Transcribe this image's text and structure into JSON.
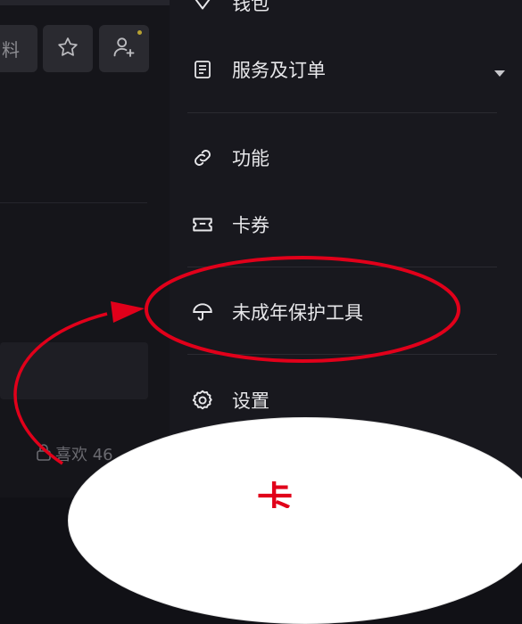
{
  "left_panel": {
    "profile_tab_label": "料",
    "likes_text": "喜欢 46"
  },
  "drawer": {
    "items": [
      {
        "label": "钱包",
        "icon": "wallet-icon"
      },
      {
        "label": "服务及订单",
        "icon": "order-icon",
        "expandable": true
      },
      {
        "label": "功能",
        "icon": "link-icon"
      },
      {
        "label": "卡券",
        "icon": "ticket-icon"
      },
      {
        "label": "未成年保护工具",
        "icon": "umbrella-icon"
      },
      {
        "label": "设置",
        "icon": "gear-icon"
      }
    ]
  },
  "annotation": {
    "bubble_text": "卡",
    "color": "#e1001a"
  },
  "colors": {
    "drawer_bg": "#18181e",
    "text": "#e7e7ea",
    "annotation_red": "#e1001a"
  }
}
